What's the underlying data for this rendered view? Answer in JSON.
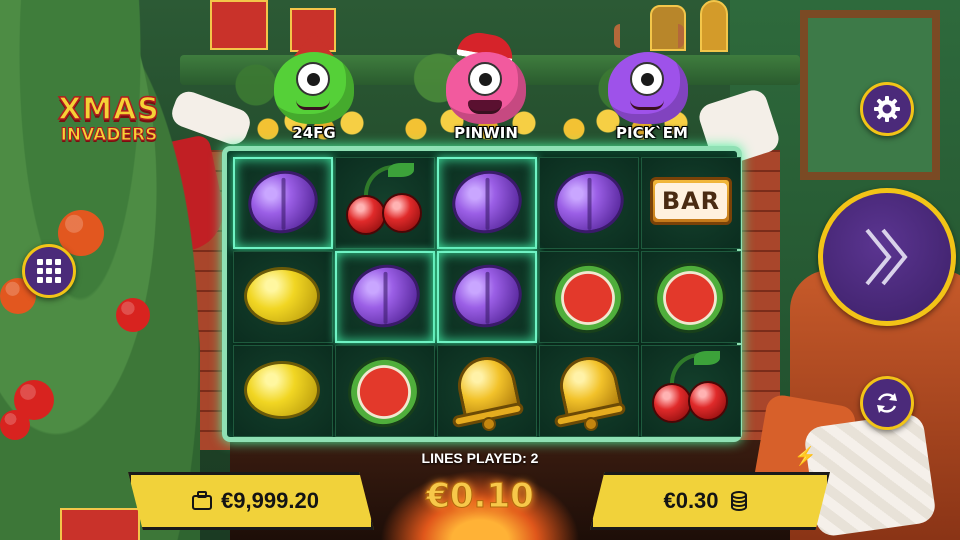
{
  "logo": {
    "line1": "XMAS",
    "line2": "INVADERS"
  },
  "features": [
    {
      "label": "24FG",
      "color": "#4fd43a"
    },
    {
      "label": "PINWIN",
      "color": "#f0549a"
    },
    {
      "label": "PICK`EM",
      "color": "#9b4fe6"
    }
  ],
  "reels": [
    [
      "plum",
      "cherry",
      "plum",
      "plum",
      "bar"
    ],
    [
      "lemon",
      "plum",
      "plum",
      "watermelon",
      "watermelon"
    ],
    [
      "lemon",
      "watermelon",
      "bell",
      "bell",
      "cherry"
    ]
  ],
  "winning_cells": [
    [
      0,
      0
    ],
    [
      0,
      2
    ],
    [
      1,
      1
    ],
    [
      1,
      2
    ]
  ],
  "bar_symbol_text": "BAR",
  "lines_played": "LINES PLAYED: 2",
  "balance": "€9,999.20",
  "bet": "€0.10",
  "win": "€0.30",
  "icons": {
    "menu": "grid-icon",
    "settings": "gear-icon",
    "spin": "double-chevron-icon",
    "autoplay": "refresh-icon",
    "balance": "briefcase-icon",
    "win": "coins-icon",
    "turbo": "lightning-icon"
  },
  "colors": {
    "accent": "#f2c417",
    "button": "#4b2a7a",
    "reel_border": "#8fe0b4"
  }
}
